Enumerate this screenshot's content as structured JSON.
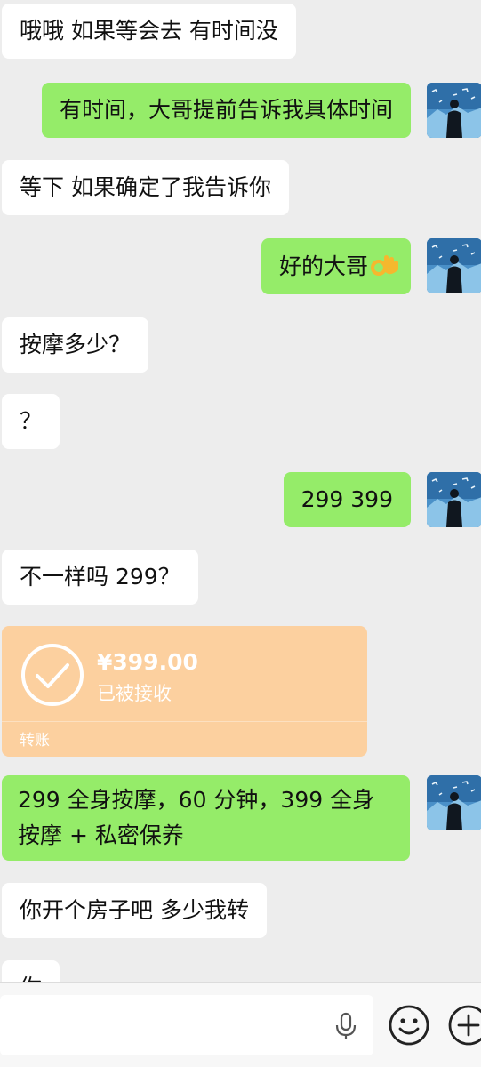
{
  "messages": [
    {
      "side": "in",
      "text": "哦哦 如果等会去 有时间没"
    },
    {
      "side": "out",
      "text": "有时间，大哥提前告诉我具体时间"
    },
    {
      "side": "in",
      "text": "等下 如果确定了我告诉你"
    },
    {
      "side": "out",
      "text": "好的大哥",
      "emoji": "ok-hand-emoji"
    },
    {
      "side": "in",
      "text": "按摩多少？"
    },
    {
      "side": "in",
      "text": "？"
    },
    {
      "side": "out",
      "text": "299    399"
    },
    {
      "side": "in",
      "text": "不一样吗 299？"
    },
    {
      "side": "out",
      "text": "299 全身按摩，60 分钟，399 全身按摩 + 私密保养"
    },
    {
      "side": "in",
      "text": "你开个房子吧 多少我转"
    },
    {
      "side": "in",
      "text": "你"
    }
  ],
  "transfer": {
    "amount": "¥399.00",
    "status": "已被接收",
    "label": "转账",
    "icon": "check-circle-icon",
    "color": "#fcd09f"
  },
  "input_bar": {
    "placeholder": "",
    "icons": [
      "microphone-icon",
      "emoji-icon",
      "plus-icon"
    ]
  },
  "colors": {
    "background": "#ededed",
    "incoming_bubble": "#ffffff",
    "outgoing_bubble": "#95ec69"
  }
}
